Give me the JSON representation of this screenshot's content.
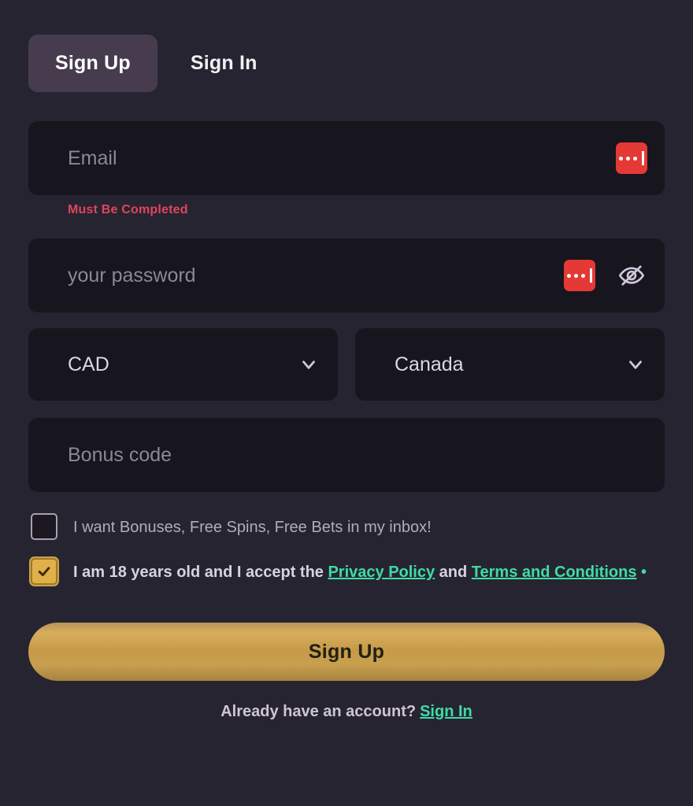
{
  "tabs": [
    {
      "label": "Sign Up",
      "active": true
    },
    {
      "label": "Sign In",
      "active": false
    }
  ],
  "form": {
    "email": {
      "placeholder": "Email",
      "value": "",
      "error": "Must Be Completed",
      "autofill_icon": "password-manager-icon"
    },
    "password": {
      "placeholder": "your password",
      "value": "",
      "autofill_icon": "password-manager-icon",
      "toggle_icon": "eye-off-icon"
    },
    "currency": {
      "value": "CAD",
      "chevron_icon": "chevron-down-icon"
    },
    "country": {
      "value": "Canada",
      "chevron_icon": "chevron-down-icon"
    },
    "bonus_code": {
      "placeholder": "Bonus code",
      "value": ""
    },
    "marketing_consent": {
      "checked": false,
      "label": "I want Bonuses, Free Spins, Free Bets in my inbox!"
    },
    "terms_consent": {
      "checked": true,
      "text_before": "I am 18 years old and I accept the ",
      "privacy_link": "Privacy Policy",
      "text_middle": " and ",
      "terms_link": "Terms and Conditions",
      "required_marker": "•"
    },
    "submit_label": "Sign Up"
  },
  "footer": {
    "prompt": "Already have an account?",
    "link": "Sign In"
  },
  "colors": {
    "background": "#272431",
    "tab_active": "#473b4e",
    "field_background": "#17151e",
    "error": "#e0445e",
    "link": "#3ddca6",
    "accent_gold": "#c59a49",
    "autofill_red": "#e53935"
  }
}
